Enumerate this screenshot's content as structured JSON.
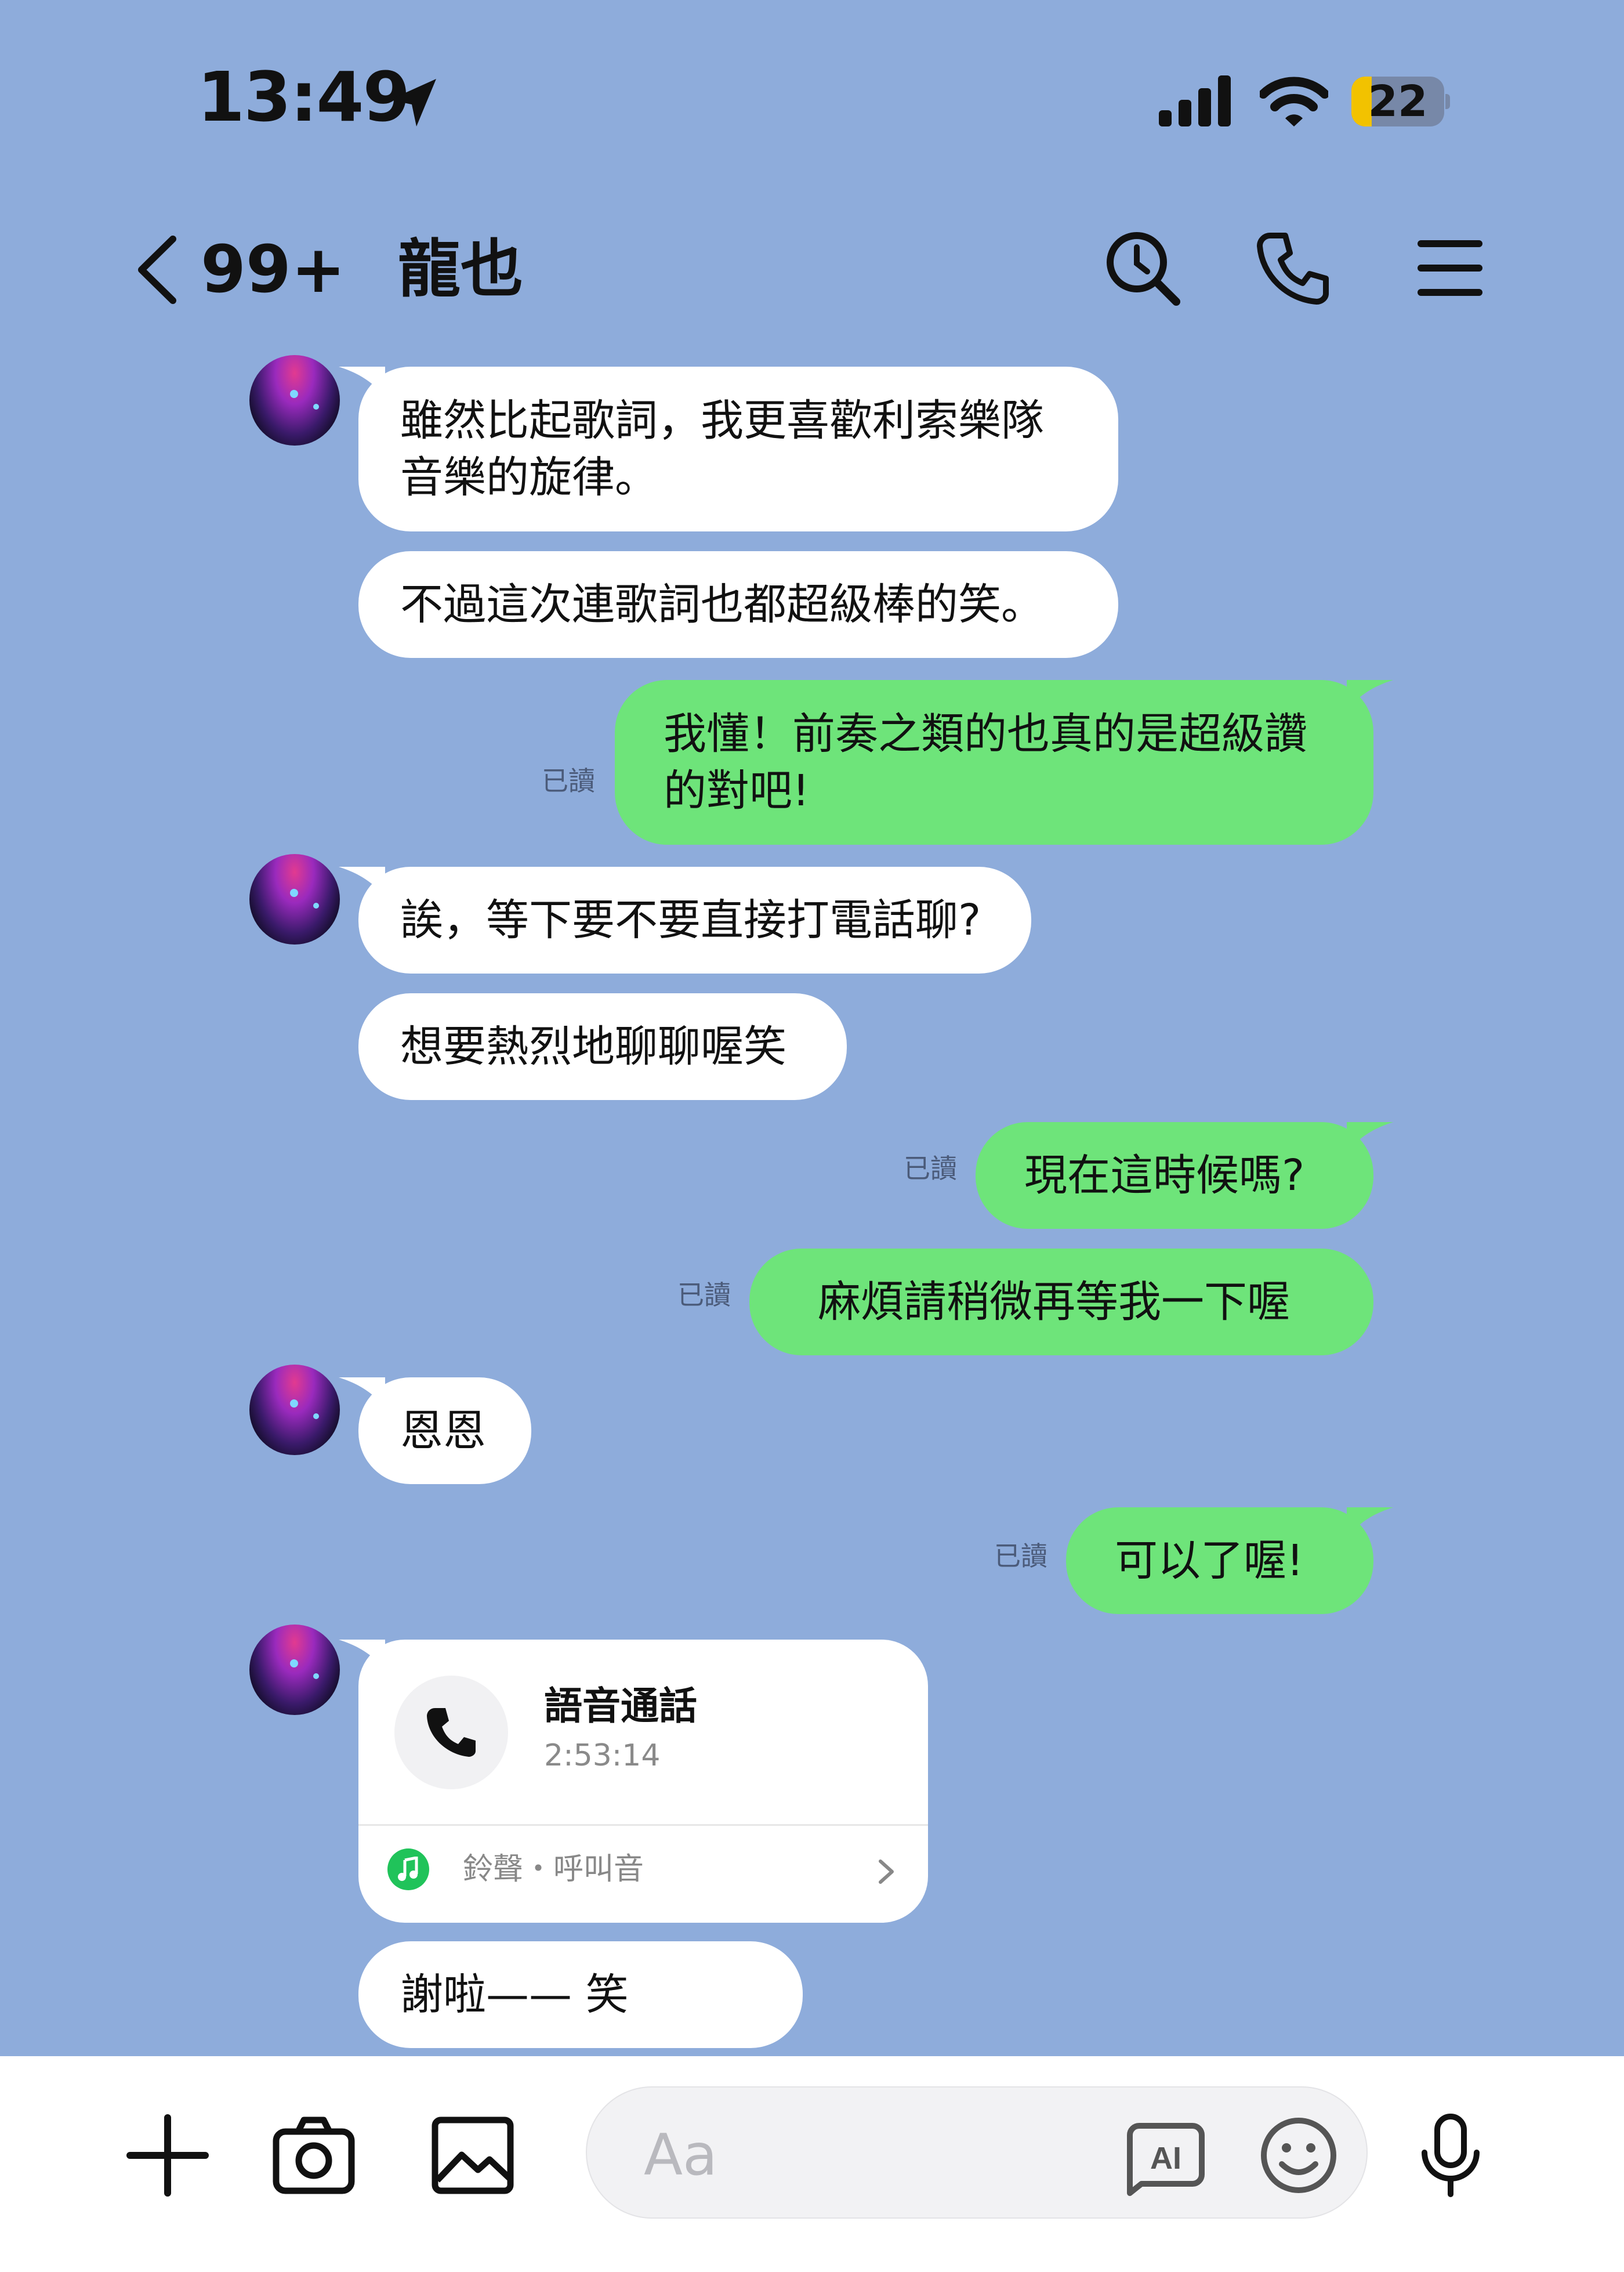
{
  "status_bar": {
    "time": "13:49",
    "battery_level": "22",
    "battery_fraction": 0.22
  },
  "header": {
    "unread_count": "99+",
    "contact_name": "龍也"
  },
  "messages": [
    {
      "side": "in",
      "lines": [
        "雖然比起歌詞，我更喜歡利索樂隊",
        "音樂的旋律。"
      ]
    },
    {
      "side": "in",
      "lines": [
        "不過這次連歌詞也都超級棒的笑。"
      ]
    },
    {
      "side": "out",
      "lines": [
        "我懂！前奏之類的也真的是超級讚",
        "的對吧!"
      ],
      "read": "已讀"
    },
    {
      "side": "in",
      "lines": [
        "誒，等下要不要直接打電話聊?"
      ]
    },
    {
      "side": "in",
      "lines": [
        "想要熱烈地聊聊喔笑"
      ]
    },
    {
      "side": "out",
      "lines": [
        "現在這時候嗎?"
      ],
      "read": "已讀"
    },
    {
      "side": "out",
      "lines": [
        "麻煩請稍微再等我一下喔"
      ],
      "read": "已讀"
    },
    {
      "side": "in",
      "lines": [
        "恩恩"
      ]
    },
    {
      "side": "out",
      "lines": [
        "可以了喔!"
      ],
      "read": "已讀"
    },
    {
      "side": "in",
      "lines": [
        "謝啦—— 笑"
      ]
    }
  ],
  "call_card": {
    "title": "語音通話",
    "duration": "2:53:14",
    "ringtone_link": "鈴聲・呼叫音"
  },
  "composer": {
    "placeholder": "Aa"
  },
  "icons": {
    "location": "location-arrow-icon",
    "signal": "cellular-signal-icon",
    "wifi": "wifi-icon",
    "battery": "battery-icon",
    "back": "chevron-left-icon",
    "search": "search-icon",
    "call": "phone-icon",
    "menu": "hamburger-menu-icon",
    "plus": "plus-icon",
    "camera": "camera-icon",
    "image": "image-icon",
    "ai": "ai-icon",
    "emoji": "emoji-icon",
    "mic": "microphone-icon"
  },
  "colors": {
    "background": "#8eacdb",
    "incoming_bubble": "#ffffff",
    "outgoing_bubble": "#6ee47a",
    "battery": "#f2c200"
  }
}
